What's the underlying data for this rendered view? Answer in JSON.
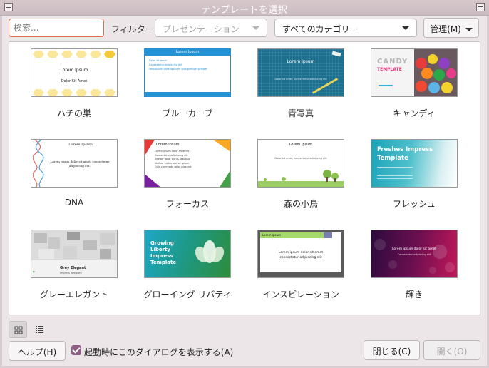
{
  "window": {
    "title": "テンプレートを選択"
  },
  "toolbar": {
    "search_placeholder": "検索...",
    "filter_label": "フィルター",
    "filter_value": "プレゼンテーション",
    "category_value": "すべてのカテゴリー",
    "manage_label": "管理(M)"
  },
  "templates": [
    {
      "label": "ハチの巣",
      "thumb": {
        "line1": "Lorem Ipsum",
        "line2": "Dolor Sit Amet"
      }
    },
    {
      "label": "ブルーカーブ",
      "thumb": {
        "title": "Lorem Ipsum",
        "bullets": [
          "Dolor sit amet",
          "Consectetur adipiscing elit",
          "Vestibulum consequat mi quis pretium semper"
        ]
      }
    },
    {
      "label": "青写真",
      "thumb": {
        "title": "Lorem Ipsum",
        "sub": "Dolor sit amet, consectetur adipiscing elit"
      }
    },
    {
      "label": "キャンディ",
      "thumb": {
        "title": "CANDY",
        "sub": "TEMPLATE"
      }
    },
    {
      "label": "DNA",
      "thumb": {
        "title": "Lorem Ipsum",
        "sub": "Lorem ipsum dolor sit amet, consectetur adipiscing elit."
      }
    },
    {
      "label": "フォーカス",
      "thumb": {
        "title": "Lorem Ipsum",
        "bullets": [
          "Lorem ipsum dolor sit amet",
          "Consectetur adipiscing elit",
          "Integer dolor purus, dapibus",
          "Nullam luctus orci ac ipsum",
          "Quis commodo dolor placerat"
        ]
      }
    },
    {
      "label": "森の小鳥",
      "thumb": {
        "title": "Lorem Ipsum",
        "sub": "Dolor sit amet, consectetur adipiscing elit"
      }
    },
    {
      "label": "フレッシュ",
      "thumb": {
        "title": "Freshes Impress Template"
      }
    },
    {
      "label": "グレーエレガント",
      "thumb": {
        "title": "Grey Elegant",
        "sub": "Impress Template"
      }
    },
    {
      "label": "グローイング リバティ",
      "thumb": {
        "title": "Growing Liberty Impress Template"
      }
    },
    {
      "label": "インスピレーション",
      "thumb": {
        "title": "Lorem Ipsum",
        "sub": "Lorem ipsum dolor sit amet consectetur adipiscing elit"
      }
    },
    {
      "label": "輝き",
      "thumb": {
        "title": "Lorem ipsum dolor sit amet",
        "sub": "Consectetur adipiscing elit"
      }
    }
  ],
  "footer": {
    "help_label": "ヘルプ(H)",
    "show_dialog_label": "起動時にこのダイアログを表示する(A)",
    "close_label": "閉じる(C)",
    "open_label": "開く(O)"
  }
}
